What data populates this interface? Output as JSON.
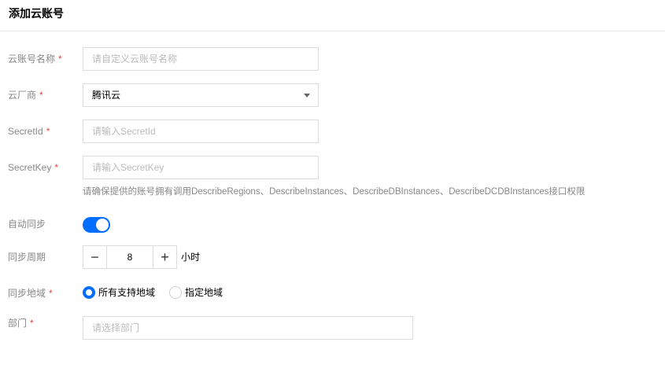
{
  "page": {
    "title": "添加云账号"
  },
  "form": {
    "account_name": {
      "label": "云账号名称",
      "placeholder": "请自定义云账号名称"
    },
    "cloud_vendor": {
      "label": "云厂商",
      "value": "腾讯云"
    },
    "secret_id": {
      "label": "SecretId",
      "placeholder": "请输入SecretId"
    },
    "secret_key": {
      "label": "SecretKey",
      "placeholder": "请输入SecretKey",
      "hint": "请确保提供的账号拥有调用DescribeRegions、DescribeInstances、DescribeDBInstances、DescribeDCDBInstances接口权限"
    },
    "auto_sync": {
      "label": "自动同步",
      "enabled": true
    },
    "sync_period": {
      "label": "同步周期",
      "minus": "−",
      "plus": "+",
      "value": "8",
      "unit": "小时"
    },
    "sync_region": {
      "label": "同步地域",
      "options": [
        {
          "label": "所有支持地域",
          "checked": true
        },
        {
          "label": "指定地域",
          "checked": false
        }
      ]
    },
    "department": {
      "label": "部门",
      "placeholder": "请选择部门"
    },
    "required_mark": "*"
  },
  "colors": {
    "accent": "#006eff",
    "required": "#e54545",
    "label": "#888888",
    "border": "#dcdcdc"
  }
}
